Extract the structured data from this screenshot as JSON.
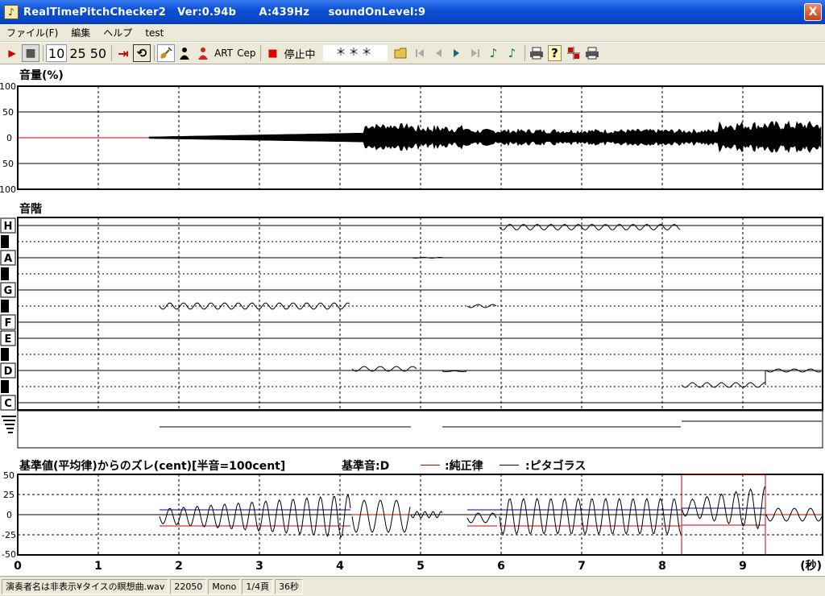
{
  "window": {
    "title": "RealTimePitchChecker2   Ver:0.94b      A:439Hz     soundOnLevel:9",
    "close_label": "X",
    "app_icon_glyph": "♪"
  },
  "menu": {
    "items": [
      "ファイル(F)",
      "編集",
      "ヘルプ",
      "test"
    ]
  },
  "toolbar": {
    "play_glyph": "▶",
    "stop_glyph": "■",
    "zoom_10": "10",
    "zoom_25": "25",
    "zoom_50": "50",
    "to_end_glyph": "⇥",
    "loop_glyph": "⟲",
    "art": "ART",
    "cep": "Cep",
    "record_glyph": "■",
    "status": "停止中",
    "note_display": "＊＊＊",
    "open_glyph": "📂",
    "help_glyph": "?"
  },
  "volume_panel": {
    "title": "音量(%)",
    "ticks": [
      "100",
      "50",
      "0",
      "50",
      "100"
    ]
  },
  "scale_panel": {
    "title": "音階",
    "notes": [
      "H",
      "A",
      "G",
      "F",
      "E",
      "D",
      "C"
    ]
  },
  "deviation_panel": {
    "title": "基準値(平均律)からのズレ(cent)[半音=100cent]",
    "reference": "基準音:D",
    "legend": [
      {
        "label": ":純正律",
        "color": "#cc0000"
      },
      {
        "label": ":ピタゴラス",
        "color": "#000099"
      }
    ],
    "ticks": [
      "50",
      "25",
      "0",
      "-25",
      "-50"
    ]
  },
  "time_axis": {
    "labels": [
      "0",
      "1",
      "2",
      "3",
      "4",
      "5",
      "6",
      "7",
      "8",
      "9"
    ],
    "unit": "(秒)"
  },
  "statusbar": {
    "file": "演奏者名は非表示¥タイスの瞑想曲.wav",
    "rate": "22050",
    "channels": "Mono",
    "page": "1/4頁",
    "duration": "36秒"
  }
}
